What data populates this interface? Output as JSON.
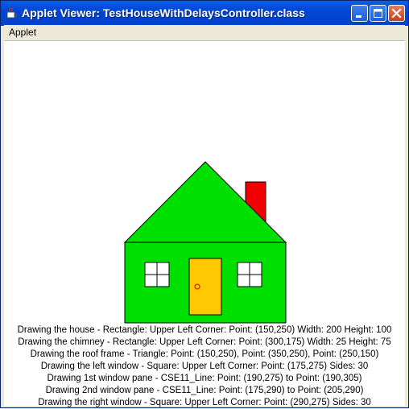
{
  "window": {
    "title": "Applet Viewer: TestHouseWithDelaysController.class",
    "menu": [
      "Applet"
    ],
    "title_bar_color": "#0046D5"
  },
  "scene": {
    "colors": {
      "house": "#00E000",
      "roof": "#00E000",
      "chimney": "#F00000",
      "door": "#FFC800",
      "doorknob": "#E00000",
      "window": "#FFFFFF",
      "outline": "#000000"
    }
  },
  "log": [
    "Drawing the house - Rectangle: Upper Left Corner: Point: (150,250) Width: 200 Height: 100",
    "Drawing the chimney - Rectangle: Upper Left Corner: Point: (300,175) Width: 25 Height: 75",
    "Drawing the roof frame - Triangle: Point: (150,250), Point: (350,250), Point: (250,150)",
    "Drawing the left window - Square: Upper Left Corner: Point: (175,275) Sides: 30",
    "Drawing 1st window pane - CSE11_Line: Point: (190,275) to Point: (190,305)",
    "Drawing 2nd window pane - CSE11_Line: Point: (175,290) to Point: (205,290)",
    "Drawing the right window - Square: Upper Left Corner: Point: (290,275) Sides: 30"
  ]
}
